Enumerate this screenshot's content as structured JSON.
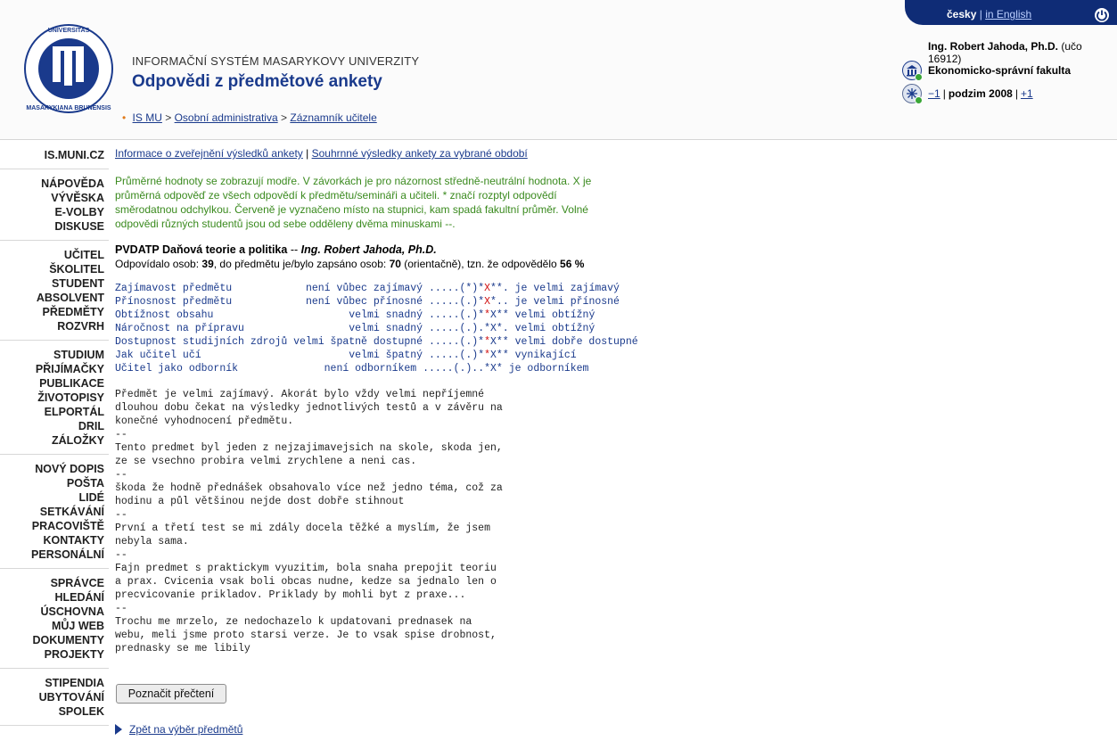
{
  "header": {
    "subtitle": "INFORMAČNÍ SYSTÉM MASARYKOVY UNIVERZITY",
    "title": "Odpovědi z předmětové ankety",
    "breadcrumb": {
      "items": [
        "IS MU",
        "Osobní administrativa",
        "Záznamník učitele"
      ],
      "separator": ">"
    },
    "lang": {
      "current": "česky",
      "other": "in English"
    },
    "user": {
      "name": "Ing. Robert Jahoda, Ph.D.",
      "uco": "(učo 16912)"
    },
    "faculty": "Ekonomicko-správní fakulta",
    "period": {
      "prev": "−1",
      "label": "podzim 2008",
      "next": "+1"
    },
    "logo_text": "UNIVERSITAS MASARYKIANA BRUNENSIS"
  },
  "sidebar": {
    "groups": [
      [
        "IS.MUNI.CZ"
      ],
      [
        "NÁPOVĚDA",
        "VÝVĚSKA",
        "E-VOLBY",
        "DISKUSE"
      ],
      [
        "UČITEL",
        "ŠKOLITEL",
        "STUDENT",
        "ABSOLVENT",
        "PŘEDMĚTY",
        "ROZVRH"
      ],
      [
        "STUDIUM",
        "PŘIJÍMAČKY",
        "PUBLIKACE",
        "ŽIVOTOPISY",
        "ELPORTÁL",
        "DRIL",
        "ZÁLOŽKY"
      ],
      [
        "NOVÝ DOPIS",
        "POŠTA",
        "LIDÉ",
        "SETKÁVÁNÍ",
        "PRACOVIŠTĚ",
        "KONTAKTY",
        "PERSONÁLNÍ"
      ],
      [
        "SPRÁVCE",
        "HLEDÁNÍ",
        "ÚSCHOVNA",
        "MŮJ WEB",
        "DOKUMENTY",
        "PROJEKTY"
      ],
      [
        "STIPENDIA",
        "UBYTOVÁNÍ",
        "SPOLEK"
      ]
    ]
  },
  "main": {
    "links": {
      "publish_info": "Informace o zveřejnění výsledků ankety",
      "summary": "Souhrnné výsledky ankety za vybrané období",
      "sep": "|"
    },
    "info_text": "Průměrné hodnoty se zobrazují modře. V závorkách je pro názornost středně-neutrální hodnota. X je průměrná odpověď ze všech odpovědí k předmětu/semináři a učiteli. * značí rozptyl odpovědí směrodatnou odchylkou. Červeně je vyznačeno místo na stupnici, kam spadá fakultní průměr. Volné odpovědi různých studentů jsou od sebe odděleny dvěma minuskami --.",
    "course": {
      "code_name": "PVDATP Daňová teorie a politika",
      "dash": " -- ",
      "teacher": "Ing. Robert Jahoda, Ph.D."
    },
    "counts": {
      "prefix": "Odpovídalo osob: ",
      "answered": "39",
      "mid": ", do předmětu je/bylo zapsáno osob: ",
      "enrolled": "70",
      "mid2": " (orientačně), tzn. že odpovědělo ",
      "percent": "56 %"
    },
    "ratings": [
      {
        "label": "Zajímavost předmětu           ",
        "low": " není vůbec zajímavý ",
        "scale_a": ".....(*)*",
        "mark": "X",
        "scale_b": "**. ",
        "high": "je velmi zajímavý"
      },
      {
        "label": "Přínosnost předmětu           ",
        "low": " není vůbec přínosné ",
        "scale_a": ".....(.)*",
        "mark": "X",
        "scale_b": "*.. ",
        "high": "je velmi přínosné"
      },
      {
        "label": "Obtížnost obsahu              ",
        "low": "        velmi snadný ",
        "scale_a": ".....(.)*",
        "mark": "*",
        "scale_b": "X** ",
        "high": "velmi obtížný"
      },
      {
        "label": "Náročnost na přípravu         ",
        "low": "        velmi snadný ",
        "scale_a": ".....(.).*",
        "mark": "",
        "scale_b": "X*. ",
        "high": "velmi obtížný"
      },
      {
        "label": "Dostupnost studijních zdrojů ",
        "low": "velmi špatně dostupné ",
        "scale_a": ".....(.)*",
        "mark": "*",
        "scale_b": "X** ",
        "high": "velmi dobře dostupné"
      },
      {
        "label": "Jak učitel učí                ",
        "low": "        velmi špatný ",
        "scale_a": ".....(.)*",
        "mark": "*",
        "scale_b": "X** ",
        "high": "vynikající"
      },
      {
        "label": "Učitel jako odborník          ",
        "low": "    není odborníkem ",
        "scale_a": ".....(.)..*",
        "mark": "",
        "scale_b": "X* ",
        "high": "je odborníkem"
      }
    ],
    "comments": [
      "Předmět je velmi zajímavý. Akorát bylo vždy velmi nepříjemné\ndlouhou dobu čekat na výsledky jednotlivých testů a v závěru na\nkonečné vyhodnocení předmětu.",
      "--",
      "Tento predmet byl jeden z nejzajimavejsich na skole, skoda jen,\nze se vsechno probira velmi zrychlene a neni cas.",
      "--",
      "škoda že hodně přednášek obsahovalo více než jedno téma, což za\nhodinu a půl většinou nejde dost dobře stihnout",
      "--",
      "První a třetí test se mi zdály docela těžké a myslím, že jsem\nnebyla sama.",
      "--",
      "Fajn predmet s praktickym vyuzitim, bola snaha prepojit teoriu\na prax. Cvicenia vsak boli obcas nudne, kedze sa jednalo len o\nprecvicovanie prikladov. Priklady by mohli byt z praxe...",
      "--",
      "Trochu me mrzelo, ze nedochazelo k updatovani prednasek na\nwebu, meli jsme proto starsi verze. Je to vsak spise drobnost,\nprednasky se me libily"
    ],
    "mark_read": "Poznačit přečtení",
    "back": "Zpět na výběr předmětů"
  }
}
